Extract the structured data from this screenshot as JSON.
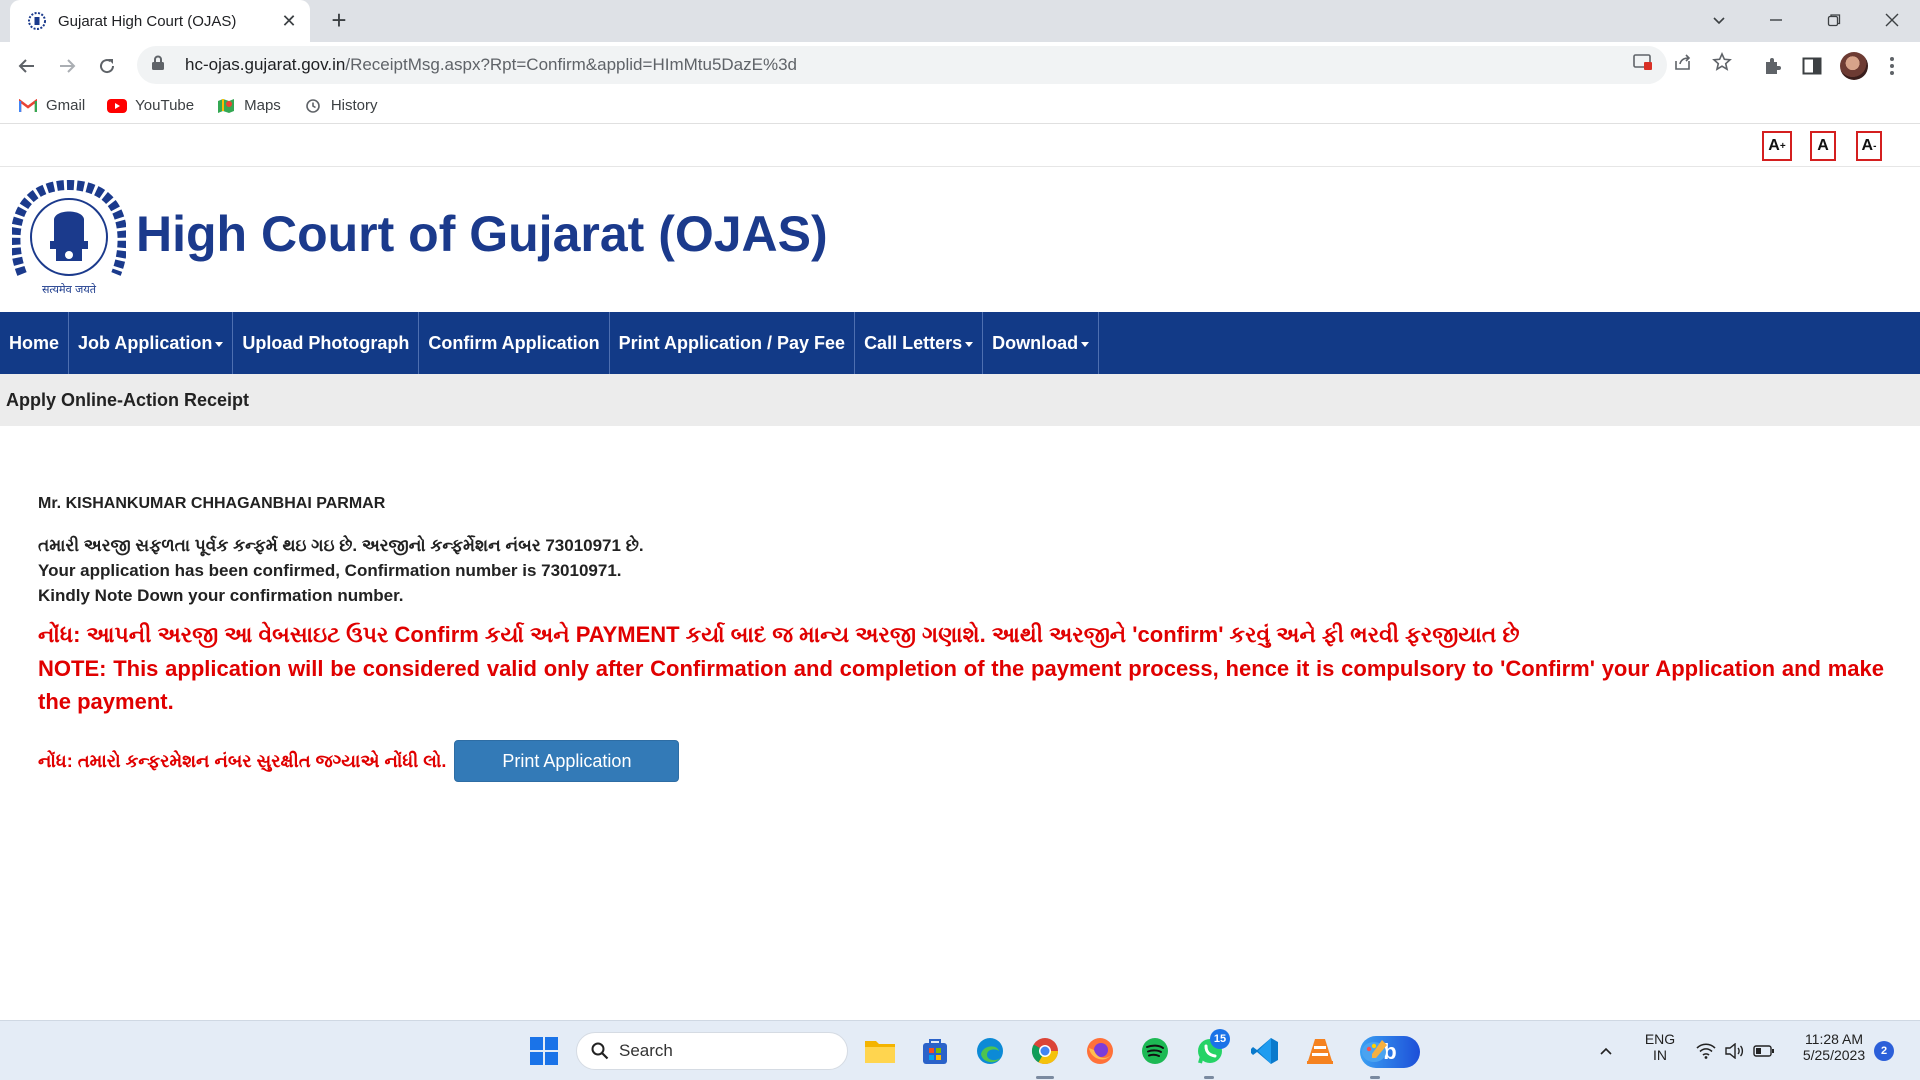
{
  "browser": {
    "tab_title": "Gujarat High Court (OJAS)",
    "url_host": "hc-ojas.gujarat.gov.in",
    "url_path": "/ReceiptMsg.aspx?Rpt=Confirm&applid=HImMtu5DazE%3d",
    "bookmarks": [
      {
        "label": "Gmail",
        "icon": "gmail-icon"
      },
      {
        "label": "YouTube",
        "icon": "youtube-icon"
      },
      {
        "label": "Maps",
        "icon": "maps-icon"
      },
      {
        "label": "History",
        "icon": "history-icon"
      }
    ]
  },
  "page": {
    "font_controls": {
      "increase": "A",
      "normal": "A",
      "decrease": "A",
      "plus": "+",
      "minus": "-"
    },
    "site_title": "High Court of Gujarat (OJAS)",
    "emblem_caption": "सत्यमेव जयते",
    "nav": [
      {
        "label": "Home",
        "dropdown": false
      },
      {
        "label": "Job Application",
        "dropdown": true
      },
      {
        "label": "Upload Photograph",
        "dropdown": false
      },
      {
        "label": "Confirm Application",
        "dropdown": false
      },
      {
        "label": "Print Application / Pay Fee",
        "dropdown": false
      },
      {
        "label": "Call Letters",
        "dropdown": true
      },
      {
        "label": "Download",
        "dropdown": true
      }
    ],
    "breadcrumb": "Apply Online-Action Receipt",
    "applicant_name": "Mr. KISHANKUMAR CHHAGANBHAI PARMAR",
    "message_gu": "તમારી અરજી સફળતા પૂર્વક કન્ફર્મ થઇ ગઇ છે. અરજીનો કન્ફર્મેશન નંબર 73010971 છે.",
    "message_en": "Your application has been confirmed, Confirmation number is 73010971.",
    "message_note": "Kindly Note Down your confirmation number.",
    "note_gu": "નોંધ: આપની અરજી આ વેબસાઇટ ઉપર Confirm કર્યા અને PAYMENT કર્યા બાદ જ માન્ય અરજી ગણાશે. આથી અરજીને 'confirm' કરવું અને ફી ભરવી ફરજીયાત છે",
    "note_en": "NOTE: This application will be considered valid only after Confirmation and completion of the payment process, hence it is compulsory to 'Confirm' your Application and make the payment.",
    "save_label": "નોંધ: તમારો કન્ફરમેશન નંબર સુરક્ષીત જગ્યાએ નોંધી લો.",
    "print_button": "Print Application"
  },
  "taskbar": {
    "search_label": "Search",
    "bing_label": "b",
    "whatsapp_badge": "15",
    "lang_top": "ENG",
    "lang_bottom": "IN",
    "time": "11:28 AM",
    "date": "5/25/2023",
    "notification_count": "2"
  },
  "colors": {
    "nav_bg": "#123a87",
    "title": "#1b3a8c",
    "alert_red": "#e00000",
    "button": "#337ab7"
  }
}
